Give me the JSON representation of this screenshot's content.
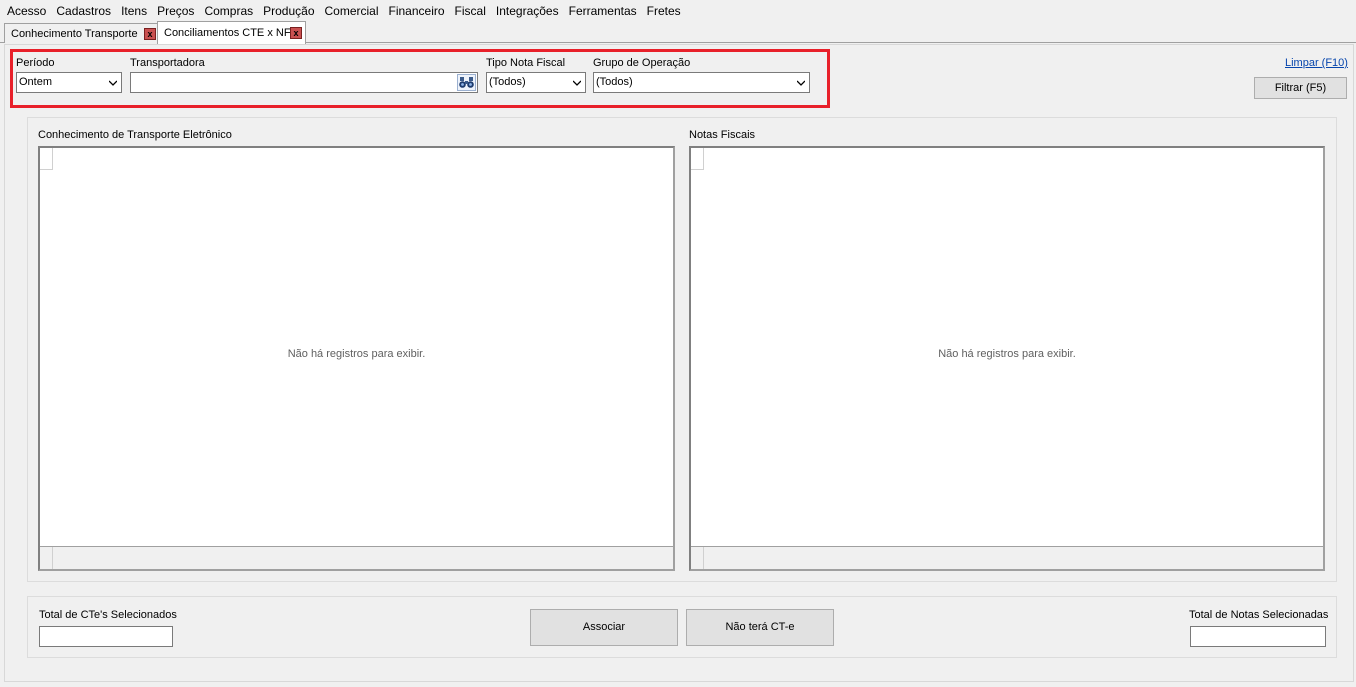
{
  "menu": [
    "Acesso",
    "Cadastros",
    "Itens",
    "Preços",
    "Compras",
    "Produção",
    "Comercial",
    "Financeiro",
    "Fiscal",
    "Integrações",
    "Ferramentas",
    "Fretes"
  ],
  "tabs": [
    {
      "label": "Conhecimento Transporte",
      "close": "x"
    },
    {
      "label": "Conciliamentos CTE x NF",
      "close": "x"
    }
  ],
  "filters": {
    "periodo_label": "Período",
    "periodo_value": "Ontem",
    "transportadora_label": "Transportadora",
    "transportadora_value": "",
    "tipo_nota_label": "Tipo Nota Fiscal",
    "tipo_nota_value": "(Todos)",
    "grupo_operacao_label": "Grupo de Operação",
    "grupo_operacao_value": "(Todos)"
  },
  "actions": {
    "limpar": "Limpar (F10)",
    "filtrar": "Filtrar (F5)"
  },
  "cte_panel": {
    "title": "Conhecimento de Transporte Eletrônico",
    "empty": "Não há registros para exibir."
  },
  "nf_panel": {
    "title": "Notas Fiscais",
    "empty": "Não há registros para exibir."
  },
  "bottom": {
    "total_cte_label": "Total de CTe's Selecionados",
    "total_cte_value": "",
    "associar": "Associar",
    "nao_tera": "Não terá CT-e",
    "total_notas_label": "Total de Notas Selecionadas",
    "total_notas_value": ""
  },
  "colors": {
    "highlight": "#e8202a",
    "link": "#0645ad"
  },
  "icons": {
    "dropdown": "chevron-down-icon",
    "search": "binoculars-icon",
    "close": "close-icon"
  }
}
